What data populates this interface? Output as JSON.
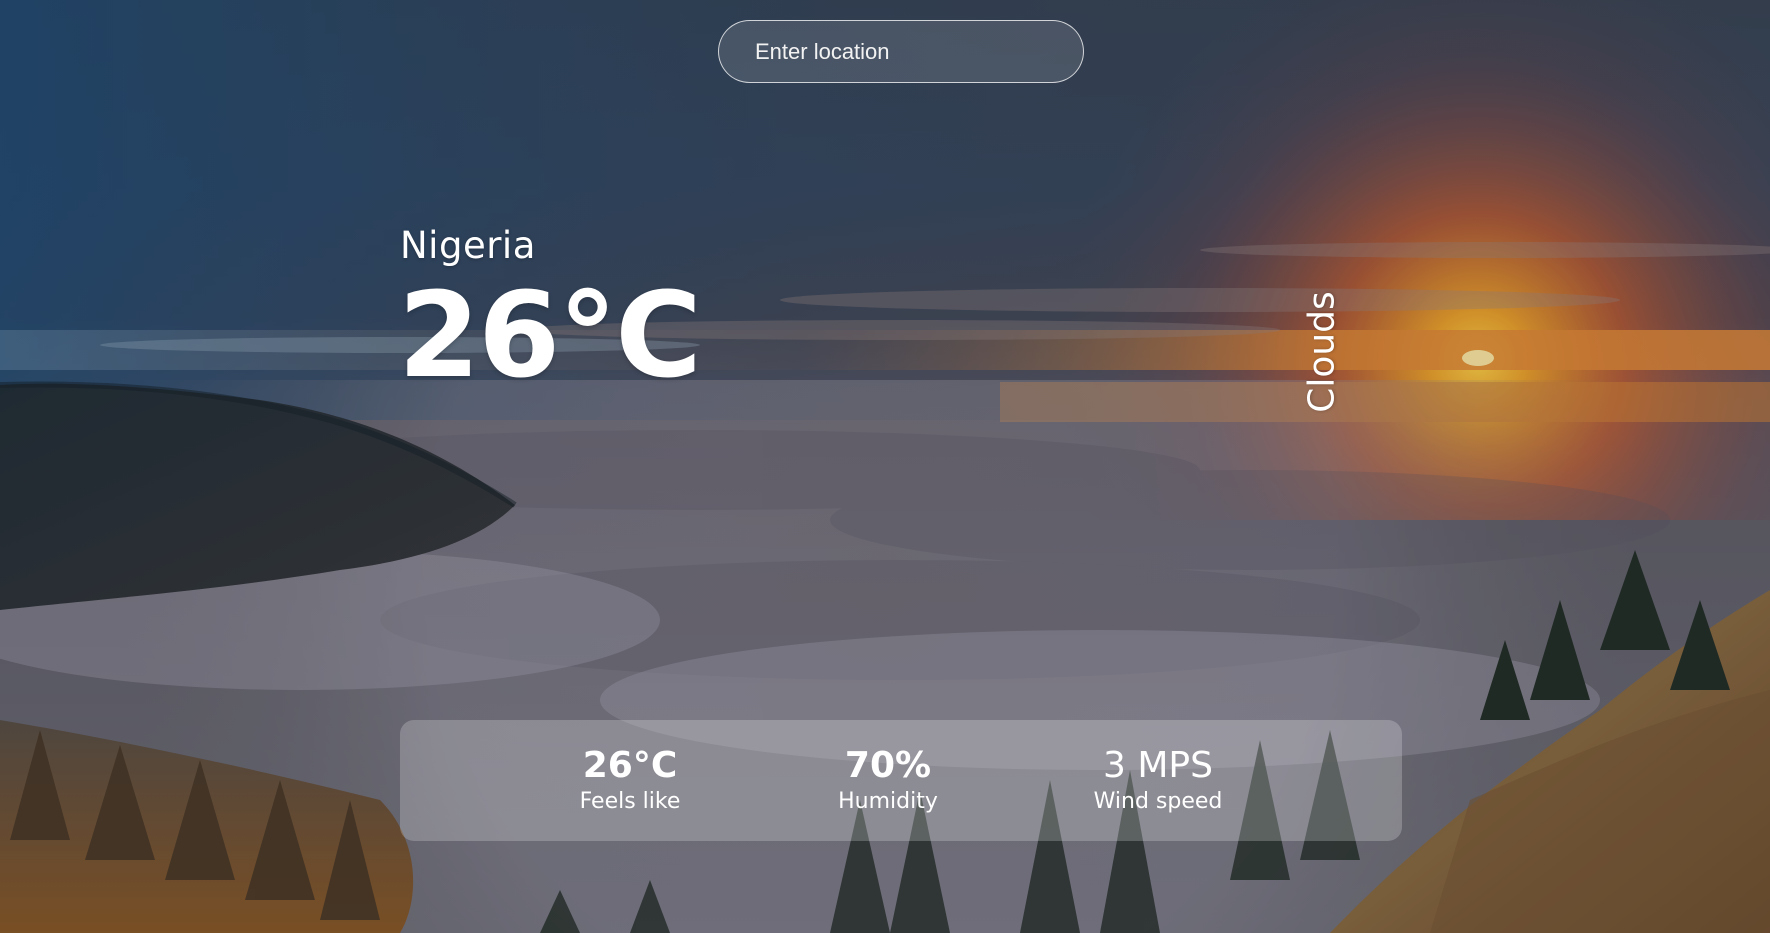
{
  "search": {
    "placeholder": "Enter location",
    "value": ""
  },
  "weather": {
    "location": "Nigeria",
    "temperature": "26°C",
    "description": "Clouds"
  },
  "stats": {
    "feels_like": {
      "value": "26°C",
      "label": "Feels like"
    },
    "humidity": {
      "value": "70%",
      "label": "Humidity"
    },
    "wind_speed": {
      "value": "3 MPS",
      "label": "Wind speed"
    }
  }
}
